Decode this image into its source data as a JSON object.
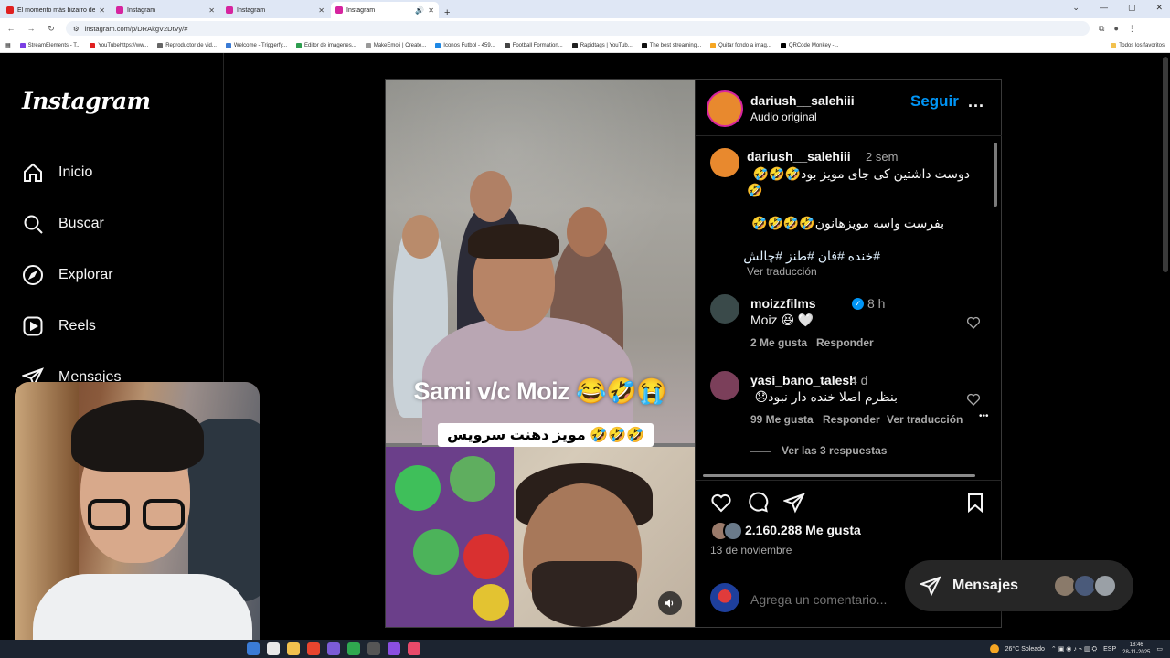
{
  "browser": {
    "tabs": [
      {
        "title": "El momento más bizarro de la...",
        "favicon_color": "#e02020",
        "active": false
      },
      {
        "title": "Instagram",
        "favicon_color": "#d6249f",
        "active": false
      },
      {
        "title": "Instagram",
        "favicon_color": "#d6249f",
        "active": false
      },
      {
        "title": "Instagram",
        "favicon_color": "#d6249f",
        "active": true
      }
    ],
    "url": "instagram.com/p/DRAkgV2DtVy/#",
    "bookmarks": [
      "StreamElements - T...",
      "YouTubehttps://ww...",
      "Reproductor de vid...",
      "Welcome - Triggerfy...",
      "Editor de imagenes...",
      "MakeEmoji | Create...",
      "Iconos Futbol - 459...",
      "Football Formation...",
      "Rapidtags | YouTub...",
      "The best streaming...",
      "Quitar fondo a imag...",
      "QRCode Monkey -..."
    ],
    "bookmarks_right": "Todos los favoritos"
  },
  "sidebar": {
    "logo": "Instagram",
    "items": [
      {
        "label": "Inicio",
        "icon": "home-icon"
      },
      {
        "label": "Buscar",
        "icon": "search-icon"
      },
      {
        "label": "Explorar",
        "icon": "compass-icon"
      },
      {
        "label": "Reels",
        "icon": "reels-icon"
      },
      {
        "label": "Mensajes",
        "icon": "send-icon"
      }
    ]
  },
  "post": {
    "media": {
      "overlay_title": "Sami v/c Moiz 😂🤣😭",
      "overlay_caption": "مویز دهنت سرویس 🤣🤣🤣"
    },
    "header": {
      "username": "dariush__salehiii",
      "subtitle": "Audio original",
      "follow_label": "Seguir",
      "more_label": "..."
    },
    "caption": {
      "username": "dariush__salehiii",
      "time": "2 sem",
      "line1": "دوست داشتین کی جای مویز بود🤣🤣🤣",
      "line1_wrap": "🤣",
      "line2": "بفرست واسه مویزهانون🤣🤣🤣🤣",
      "hashtags": "#خنده #فان #طنز #چالش",
      "translate": "Ver traducción"
    },
    "comments": [
      {
        "username": "moizzfilms",
        "verified": true,
        "time": "8 h",
        "text": "Moiz 😆 🤍",
        "likes": "2 Me gusta",
        "reply": "Responder"
      },
      {
        "username": "yasi_bano_talesh",
        "verified": false,
        "time": "4 d",
        "text": "بنظرم اصلا خنده دار نبود😞",
        "likes": "99 Me gusta",
        "reply": "Responder",
        "translate": "Ver traducción",
        "more": "•••",
        "view_replies": "Ver las 3 respuestas"
      }
    ],
    "likes_count": "2.160.288 Me gusta",
    "date": "13 de noviembre",
    "comment_placeholder": "Agrega un comentario..."
  },
  "messages_pill": {
    "label": "Mensajes"
  },
  "taskbar": {
    "weather": "26°C  Soleado",
    "lang": "ESP",
    "time": "18:46",
    "date": "28-11-2025"
  }
}
